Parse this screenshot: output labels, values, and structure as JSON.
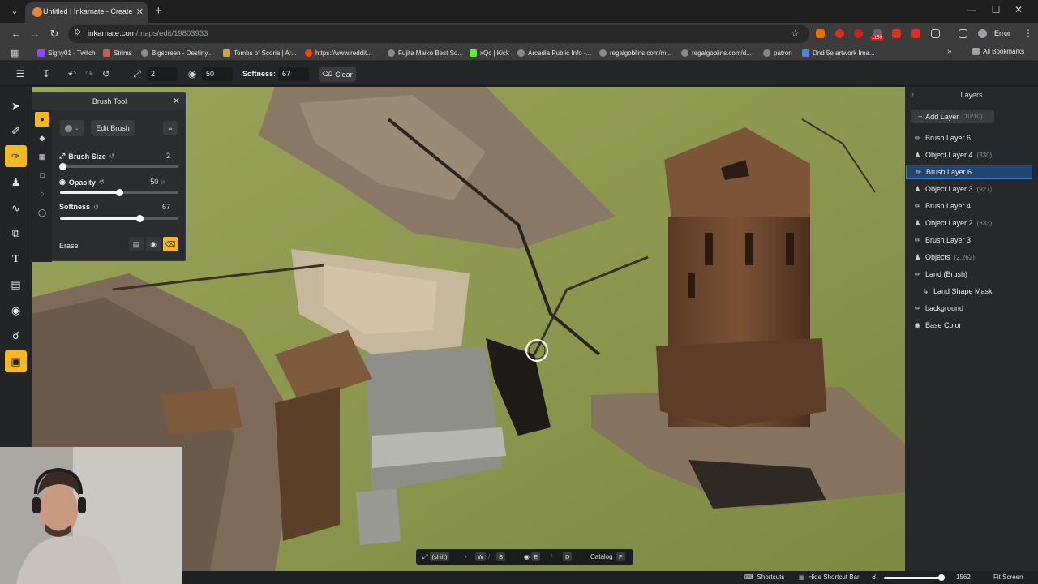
{
  "browser": {
    "tab_title": "Untitled | Inkarnate - Create Fa",
    "url_host": "inkarnate.com",
    "url_path": "/maps/edit/19803933",
    "ext_badge": "1159",
    "error_label": "Error",
    "bookmarks": [
      {
        "label": "Signy01 - Twitch",
        "color": "#9146ff"
      },
      {
        "label": "Strims",
        "color": "#d9534f"
      },
      {
        "label": "Bigscreen - Destiny...",
        "color": "#8a8a8a"
      },
      {
        "label": "Tombs of Scoria | Ar...",
        "color": "#d8a23a"
      },
      {
        "label": "https://www.reddit...",
        "color": "#ff4500"
      },
      {
        "label": "Fujita Maiko Best So...",
        "color": "#8a8a8a"
      },
      {
        "label": "xQc | Kick",
        "color": "#53fc18"
      },
      {
        "label": "Arcadia Public Info -...",
        "color": "#8a8a8a"
      },
      {
        "label": "regalgoblins.com/m...",
        "color": "#8a8a8a"
      },
      {
        "label": "regalgoblins.com/d...",
        "color": "#8a8a8a"
      },
      {
        "label": "patron",
        "color": "#8a8a8a"
      },
      {
        "label": "Dnd 5e artwork Ima...",
        "color": "#4285f4"
      }
    ],
    "all_bookmarks": "All Bookmarks"
  },
  "toolbar": {
    "size_value": "2",
    "opacity_value": "50",
    "softness_label": "Softness:",
    "softness_value": "67",
    "clear_label": "Clear"
  },
  "brush_panel": {
    "title": "Brush Tool",
    "edit_brush": "Edit Brush",
    "brush_size_label": "Brush Size",
    "brush_size_value": "2",
    "brush_size_level": 0.02,
    "opacity_label": "Opacity",
    "opacity_value": "50",
    "opacity_unit": "%",
    "opacity_level": 0.5,
    "softness_label": "Softness",
    "softness_value": "67",
    "softness_level": 0.67,
    "erase_label": "Erase"
  },
  "layers": {
    "title": "Layers",
    "add_layer": "Add Layer",
    "add_layer_count": "(10/10)",
    "items": [
      {
        "label": "Brush Layer 6",
        "count": "",
        "icon": "brush-icon",
        "selected": false
      },
      {
        "label": "Object Layer 4",
        "count": "(330)",
        "icon": "object-icon",
        "selected": false
      },
      {
        "label": "Brush Layer 6",
        "count": "",
        "icon": "brush-icon",
        "selected": true
      },
      {
        "label": "Object Layer 3",
        "count": "(927)",
        "icon": "object-icon",
        "selected": false
      },
      {
        "label": "Brush Layer 4",
        "count": "",
        "icon": "brush-icon",
        "selected": false
      },
      {
        "label": "Object Layer 2",
        "count": "(333)",
        "icon": "object-icon",
        "selected": false
      },
      {
        "label": "Brush Layer 3",
        "count": "",
        "icon": "brush-icon",
        "selected": false
      },
      {
        "label": "Objects",
        "count": "(2,262)",
        "icon": "object-icon",
        "selected": false
      },
      {
        "label": "Land (Brush)",
        "count": "",
        "icon": "brush-icon",
        "selected": false
      },
      {
        "label": "Land Shape Mask",
        "count": "",
        "icon": "mask-icon",
        "selected": false
      },
      {
        "label": "background",
        "count": "",
        "icon": "brush-icon",
        "selected": false
      },
      {
        "label": "Base Color",
        "count": "",
        "icon": "palette-icon",
        "selected": false
      }
    ]
  },
  "shortcut_bar": {
    "shift": "(shift)",
    "w": "W",
    "s": "S",
    "e": "E",
    "d": "D",
    "catalog": "Catalog",
    "f": "F"
  },
  "status_bar": {
    "shortcuts": "Shortcuts",
    "hide_shortcut_bar": "Hide Shortcut Bar",
    "zoom_value": "1562",
    "zoom_level": 0.95,
    "fit_screen": "Fit Screen"
  }
}
